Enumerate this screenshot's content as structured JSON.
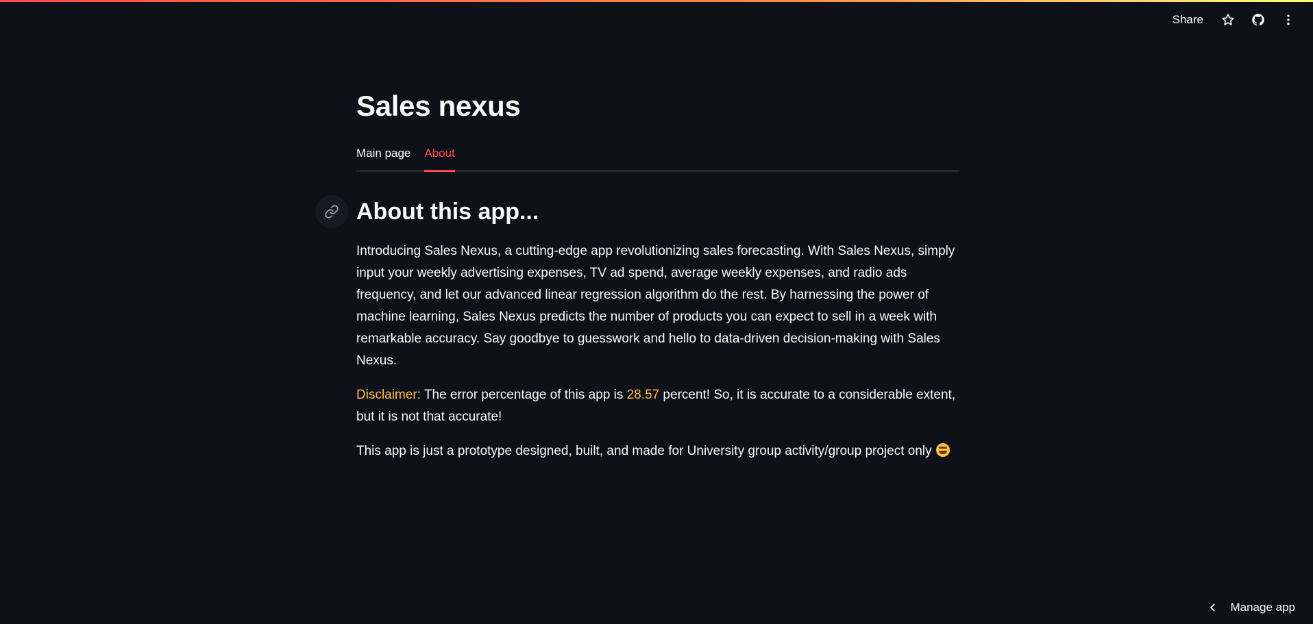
{
  "header": {
    "share_label": "Share",
    "star_icon": "star-icon",
    "github_icon": "github-icon",
    "menu_icon": "more-vertical-icon"
  },
  "main": {
    "title": "Sales nexus",
    "tabs": [
      {
        "label": "Main page",
        "active": false
      },
      {
        "label": "About",
        "active": true
      }
    ],
    "section_title": "About this app...",
    "intro": "Introducing Sales Nexus, a cutting-edge app revolutionizing sales forecasting. With Sales Nexus, simply input your weekly advertising expenses, TV ad spend, average weekly expenses, and radio ads frequency, and let our advanced linear regression algorithm do the rest. By harnessing the power of machine learning, Sales Nexus predicts the number of products you can expect to sell in a week with remarkable accuracy. Say goodbye to guesswork and hello to data-driven decision-making with Sales Nexus.",
    "disclaimer_label": "Disclaimer:",
    "disclaimer_pre": " The error percentage of this app is ",
    "disclaimer_value": "28.57",
    "disclaimer_post": " percent! So, it is accurate to a considerable extent, but it is not that accurate!",
    "footer_note": "This app is just a prototype designed, built, and made for University group activity/group project only"
  },
  "footer": {
    "manage_label": "Manage app"
  },
  "colors": {
    "background": "#0e1117",
    "accent": "#ff4b4b",
    "highlight": "#ffbd45"
  }
}
